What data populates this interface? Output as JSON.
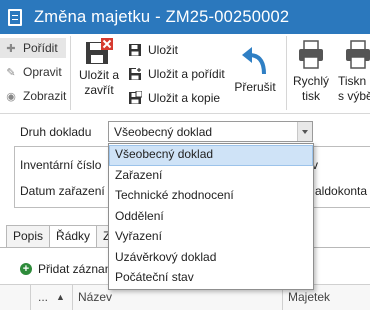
{
  "window": {
    "title": "Změna majetku - ZM25-00250002"
  },
  "ribbon": {
    "record_actions": [
      {
        "label": "Pořídit",
        "icon": "plus-icon"
      },
      {
        "label": "Opravit",
        "icon": "pencil-icon"
      },
      {
        "label": "Zobrazit",
        "icon": "eye-icon"
      }
    ],
    "save_close_label_line1": "Uložit a",
    "save_close_label_line2": "zavřít",
    "save_actions": [
      {
        "label": "Uložit"
      },
      {
        "label": "Uložit a pořídit"
      },
      {
        "label": "Uložit a kopie"
      }
    ],
    "recalc_label": "Přerušit",
    "quick_print_line1": "Rychlý",
    "quick_print_line2": "tisk",
    "print_choice_line1": "Tiskn",
    "print_choice_line2": "s výbě"
  },
  "form": {
    "doc_type_label": "Druh dokladu",
    "doc_type_value": "Všeobecný doklad",
    "inventory_label": "Inventární číslo",
    "date_label": "Datum zařazení",
    "suffix_v": "v",
    "suffix_saldo": "aldokonta"
  },
  "tabs": [
    {
      "label": "Popis"
    },
    {
      "label": "Řádky"
    },
    {
      "label": "Z"
    }
  ],
  "rows_section": {
    "add_label": "Přidat záznam",
    "columns": {
      "dots": "...",
      "name": "Název",
      "asset": "Majetek"
    }
  },
  "dropdown": {
    "options": [
      "Všeobecný doklad",
      "Zařazení",
      "Technické zhodnocení",
      "Oddělení",
      "Vyřazení",
      "Uzávěrkový doklad",
      "Počáteční stav"
    ],
    "selected": "Všeobecný doklad"
  },
  "colors": {
    "titlebar": "#2b78bd",
    "selection": "#cfe3f7",
    "add_icon": "#2e8b3a",
    "close_x": "#d63a2f",
    "recalc_arrow": "#2f7fc4"
  }
}
